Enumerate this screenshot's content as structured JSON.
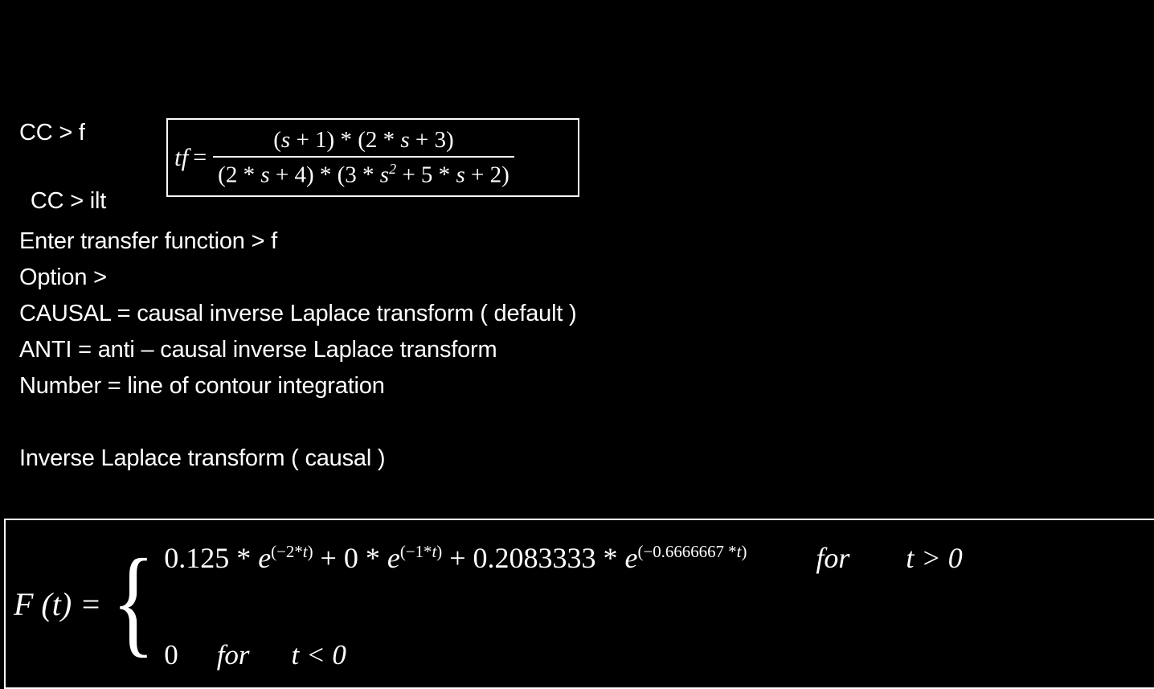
{
  "screen": {
    "background_color": "#000000",
    "text_color": "#ffffff"
  },
  "console": {
    "prompt_1": "CC > f",
    "prompt_2": " CC > ilt",
    "line_enter_tf": "Enter transfer function > f",
    "line_option": "Option >",
    "line_causal": "CAUSAL = causal inverse Laplace transform ( default )",
    "line_anti": "ANTI = anti – causal inverse Laplace transform",
    "line_number": "Number = line of contour integration",
    "line_result_header": "Inverse Laplace transform ( causal )"
  },
  "transfer_function_box": {
    "lhs": "tf",
    "equals": "=",
    "numerator": "(s + 1) * (2 * s + 3)",
    "numerator_parts": {
      "p1_open": "(",
      "p1_var": "s",
      "p1_rest": " + 1) * (2 * ",
      "p2_var": "s",
      "p2_rest": " + 3)"
    },
    "denominator": "(2 * s + 4) * (3 * s^2 + 5 * s + 2)",
    "denominator_parts": {
      "d1": "(2 * ",
      "d1_var": "s",
      "d2": " + 4) * (3 * ",
      "d2_var": "s",
      "d2_exp": "2",
      "d3": " + 5 * ",
      "d3_var": "s",
      "d4": " + 2)"
    }
  },
  "result_box": {
    "function_label": "F (t) =",
    "brace": "{",
    "case_1": {
      "c1_coef": "0.125",
      "c1_mul": " * ",
      "c1_e": "e",
      "c1_exp_open": "(",
      "c1_exp": "−2*",
      "c1_exp_var": "t",
      "c1_exp_close": ")",
      "plus_1": " + ",
      "c2_coef": "0",
      "c2_mul": " * ",
      "c2_e": "e",
      "c2_exp_open": "(",
      "c2_exp": "−1*",
      "c2_exp_var": "t",
      "c2_exp_close": ")",
      "plus_2": " + ",
      "c3_coef": "0.2083333",
      "c3_mul": "  * ",
      "c3_e": "e",
      "c3_exp_open": "(",
      "c3_exp": "−0.6666667 *",
      "c3_exp_var": "t",
      "c3_exp_close": ")",
      "for_word": "for",
      "condition": "t > 0"
    },
    "case_2": {
      "value": "0",
      "for_word": "for",
      "condition": "t < 0"
    }
  }
}
